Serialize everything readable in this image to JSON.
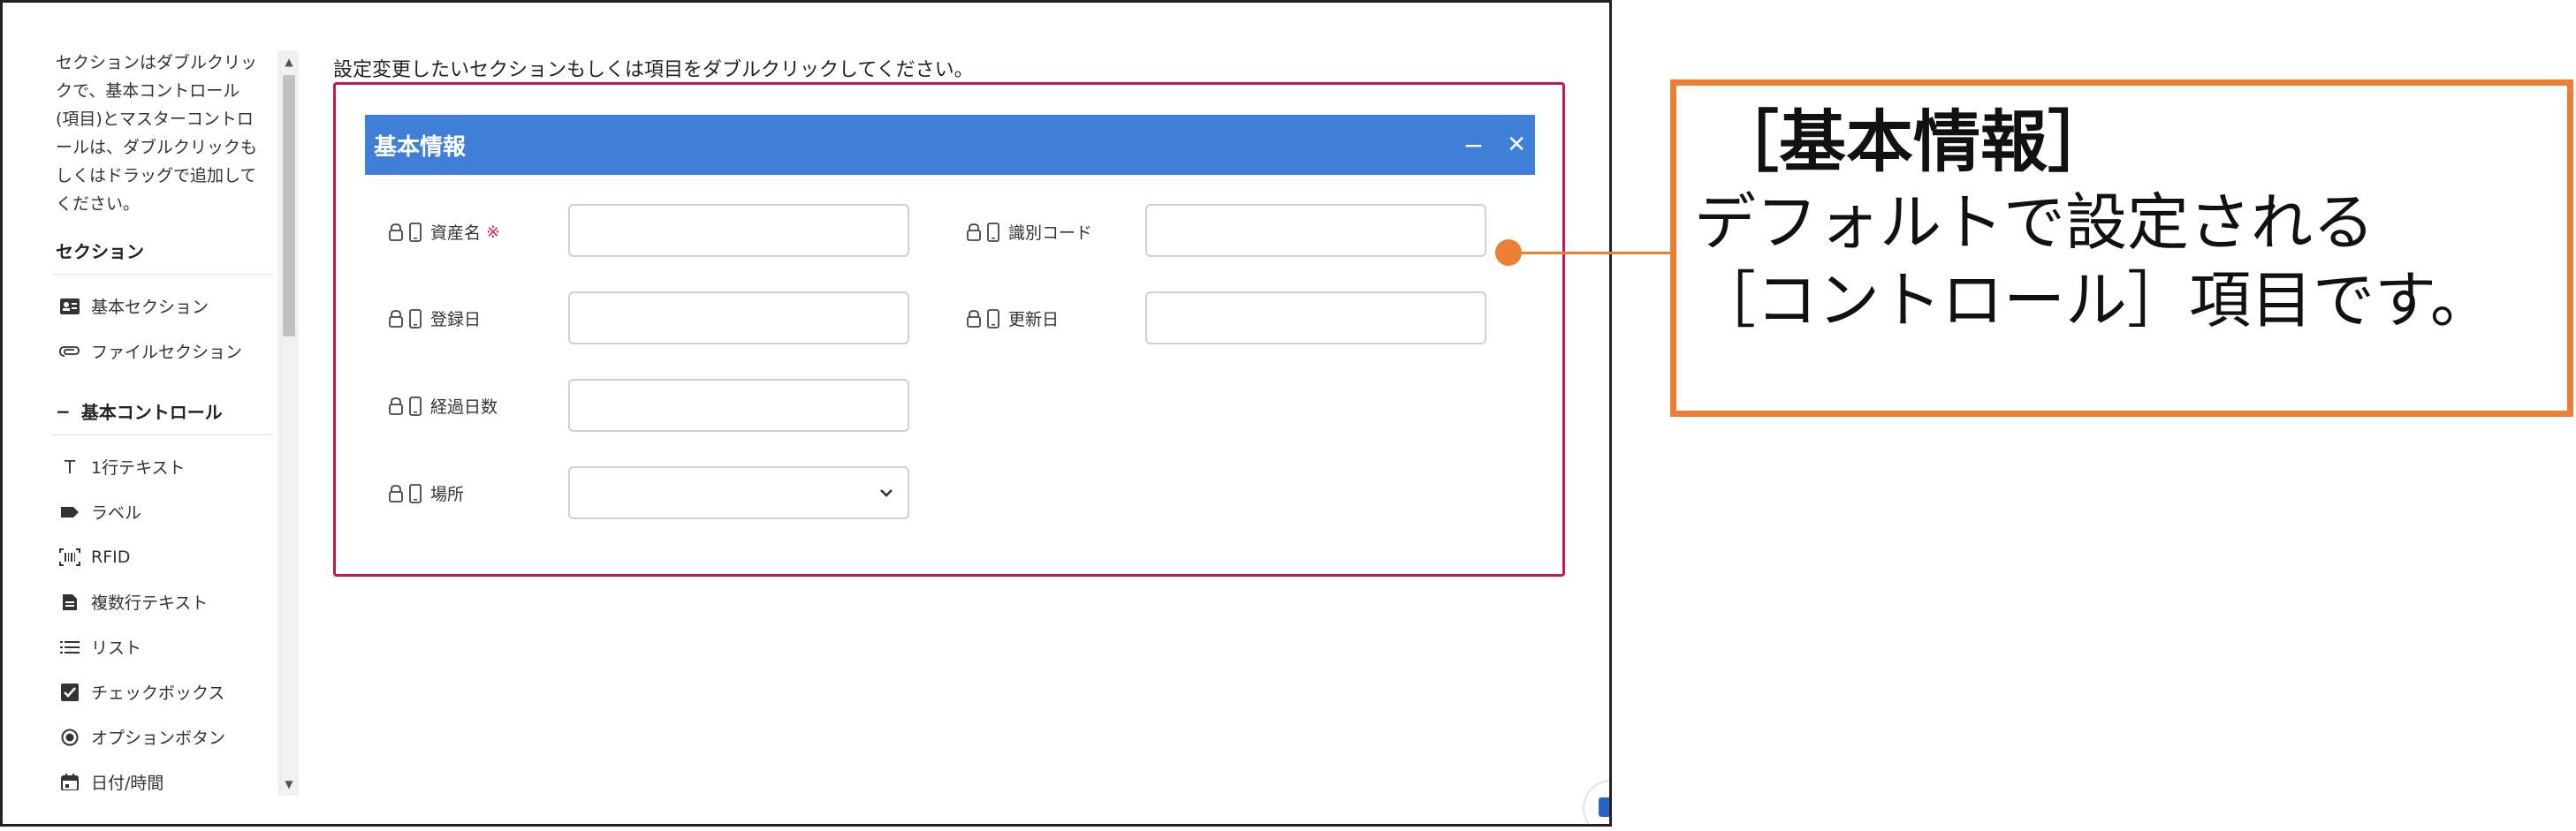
{
  "palette": {
    "help_lines": [
      "セクションはダブルクリッ",
      "クで、基本コントロール",
      "(項目)とマスターコントロ",
      "ールは、ダブルクリックも",
      "しくはドラッグで追加して",
      "ください。"
    ],
    "sections_heading": "セクション",
    "section_items": [
      {
        "label": "基本セクション",
        "icon": "id-card-icon"
      },
      {
        "label": "ファイルセクション",
        "icon": "paperclip-icon"
      }
    ],
    "controls_heading": "基本コントロール",
    "control_items": [
      {
        "label": "1行テキスト",
        "icon": "text-icon"
      },
      {
        "label": "ラベル",
        "icon": "tag-icon"
      },
      {
        "label": "RFID",
        "icon": "rfid-icon"
      },
      {
        "label": "複数行テキスト",
        "icon": "document-icon"
      },
      {
        "label": "リスト",
        "icon": "list-icon"
      },
      {
        "label": "チェックボックス",
        "icon": "checkbox-icon"
      },
      {
        "label": "オプションボタン",
        "icon": "radio-icon"
      },
      {
        "label": "日付/時間",
        "icon": "calendar-icon"
      }
    ]
  },
  "main": {
    "instruction": "設定変更したいセクションもしくは項目をダブルクリックしてください。",
    "section_title": "基本情報",
    "minimize_label": "−",
    "close_label": "✕",
    "fields": [
      {
        "label": "資産名",
        "required_mark": "※"
      },
      {
        "label": "識別コード"
      },
      {
        "label": "登録日"
      },
      {
        "label": "更新日"
      },
      {
        "label": "経過日数"
      },
      {
        "label": "場所"
      }
    ]
  },
  "callout": {
    "title": "［基本情報］",
    "line1": "デフォルトで設定される",
    "line2": "［コントロール］項目です。"
  },
  "colors": {
    "header_blue": "#3f7fd7",
    "frame_red": "#c8164f",
    "callout_orange": "#ed7d31",
    "required_red": "#e0215b"
  }
}
